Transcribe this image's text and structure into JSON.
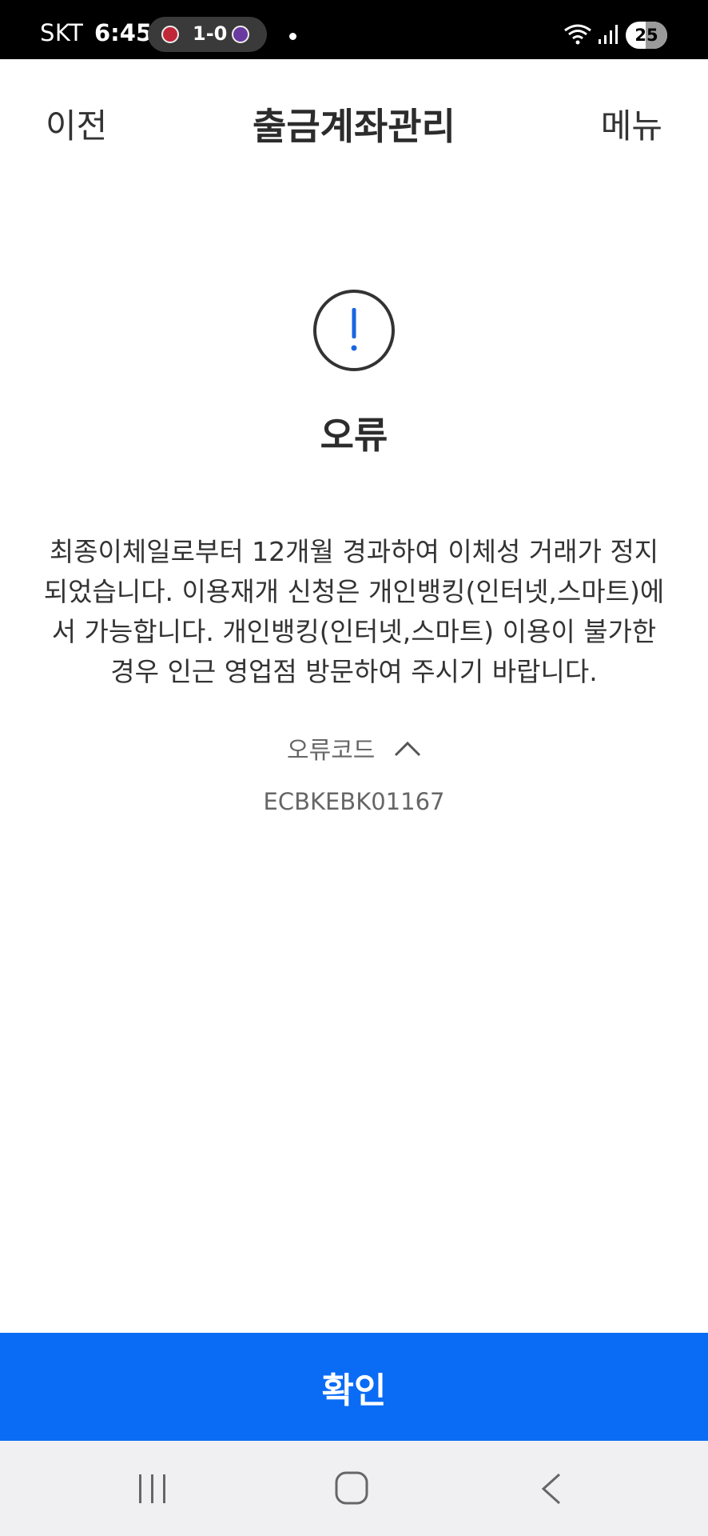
{
  "status_bar": {
    "carrier": "SKT",
    "time": "6:45",
    "score": "1-0",
    "battery": "25"
  },
  "header": {
    "back_label": "이전",
    "title": "출금계좌관리",
    "menu_label": "메뉴"
  },
  "dialog": {
    "title": "오류",
    "message": "최종이체일로부터 12개월 경과하여 이체성 거래가 정지되었습니다. 이용재개 신청은 개인뱅킹(인터넷,스마트)에서 가능합니다. 개인뱅킹(인터넷,스마트) 이용이 불가한 경우 인근 영업점 방문하여 주시기 바랍니다.",
    "code_label": "오류코드",
    "code_value": "ECBKEBK01167"
  },
  "footer": {
    "confirm_label": "확인"
  },
  "colors": {
    "accent": "#0a6cf5",
    "alert_mark": "#1a66e0"
  },
  "icons": [
    "alert-icon",
    "chevron-up-icon",
    "wifi-icon",
    "signal-icon",
    "recents-icon",
    "home-icon",
    "back-icon"
  ]
}
